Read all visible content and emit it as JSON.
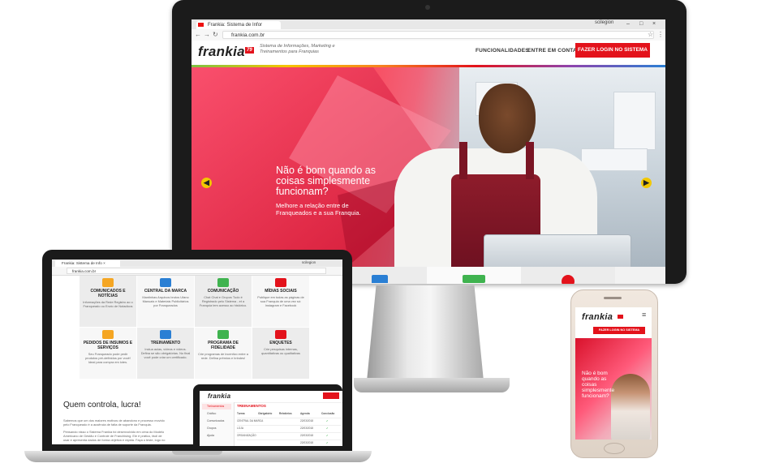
{
  "monitor": {
    "browser": {
      "tab_title": "Frankia: Sistema de Infor",
      "user_chip": "scilegion",
      "url": "frankia.com.br",
      "back": "←",
      "forward": "→",
      "reload": "↻",
      "star": "☆",
      "menu": "⋮",
      "minimize": "–",
      "maximize": "□",
      "close": "×"
    },
    "site": {
      "logo": "frankia",
      "logo_mark": "79",
      "tagline": "Sistema de Informações, Marketing e Treinamentos para Franquias",
      "nav": [
        "FUNCIONALIDADES",
        "ENTRE EM CONTATO"
      ],
      "login_button": "FAZER LOGIN NO SISTEMA",
      "hero_heading": "Não é bom quando as coisas simplesmente funcionam?",
      "hero_sub": "Melhore a relação entre de Franqueados e a sua Franquia.",
      "arrow_left": "◀",
      "arrow_right": "▶"
    }
  },
  "laptop": {
    "browser": {
      "tab_title": "Frankia: Sistema de Info ×",
      "user_chip": "scilegion",
      "url": "frankia.com.br"
    },
    "features": [
      {
        "title": "COMUNICADOS E NOTÍCIAS",
        "desc": "Informações da Rede Registro ao o Franqueado ou Envio de Notadicos",
        "color": "#f5a623"
      },
      {
        "title": "CENTRAL DA MARCA",
        "desc": "Mantinhas Arquivos brutos Ufano Manuais e Materiais Publicitários por Franqueados",
        "color": "#2a7fd4"
      },
      {
        "title": "COMUNICAÇÃO",
        "desc": "Chat Chat e Grupos Tudo é Registrado pelo Sistema - et a Franquia tem acesso ao histórico.",
        "color": "#3fb34f"
      },
      {
        "title": "MÍDIAS SOCIAIS",
        "desc": "Publique em todas as páginas de sua Franquia de uma vez só: Instagram e Facebook",
        "color": "#e3121b"
      },
      {
        "title": "PEDIDOS DE INSUMOS E SERVIÇOS",
        "desc": "Seu Franqueado pode pedir produtos pré-definidos por você! Ideal para compra em lotes.",
        "color": "#f5a623"
      },
      {
        "title": "TREINAMENTO",
        "desc": "Inclua aulas, vídeos e vídeos. Defina se são obrigatórias. No final você pode criar um certificado.",
        "color": "#2a7fd4"
      },
      {
        "title": "PROGRAMA DE FIDELIDADE",
        "desc": "Crie programas de incentivo entre a rede. Defina prêmios e brindes!",
        "color": "#3fb34f"
      },
      {
        "title": "ENQUETES",
        "desc": "Crie pesquisas internas, quantitativas ou qualitativas",
        "color": "#e3121b"
      }
    ],
    "quem_title": "Quem controla, lucra!",
    "quem_p1": "Sabemos que um dos maiores motivos de abandono e processo movido pelo Franqueado é a ausência de falta de suporte da Franquia.",
    "quem_p2": "Pensando nisso o Sistema Frankia foi desenvolvido em cima do Modelo Americano de Gestão e Controle de Franchising. Ele é prático, fácil de usar e apresenta dados de forma objetiva e rápida. Faça o teste, logo no"
  },
  "tablet": {
    "logo": "frankia",
    "section": "TREINAMENTOS",
    "sidebar": [
      "Treinamentos",
      "Gráfico",
      "Comunicados",
      "Grupos",
      "Ajuda"
    ],
    "table_headers": [
      "Turma",
      "Obrigatório",
      "Relatórios",
      "Agenda",
      "Conclusão"
    ],
    "rows": [
      {
        "name": "CENTRAL DA MARCA",
        "date": "22/03/2018",
        "status": "✔"
      },
      {
        "name": "LOJA",
        "date": "22/03/2018",
        "status": "✔"
      },
      {
        "name": "ORGANIZAÇÃO",
        "date": "22/03/2018",
        "status": "✔"
      },
      {
        "name": "",
        "date": "22/03/2018",
        "status": "✔"
      }
    ]
  },
  "phone": {
    "logo": "frankia",
    "login_button": "FAZER LOGIN NO SISTEMA",
    "hero_heading": "Não é bom quando as coisas simplesmente funcionam?",
    "hamburger": "≡"
  },
  "colors": {
    "brand_red": "#e3121b",
    "arrow_yellow": "#f2c800"
  }
}
